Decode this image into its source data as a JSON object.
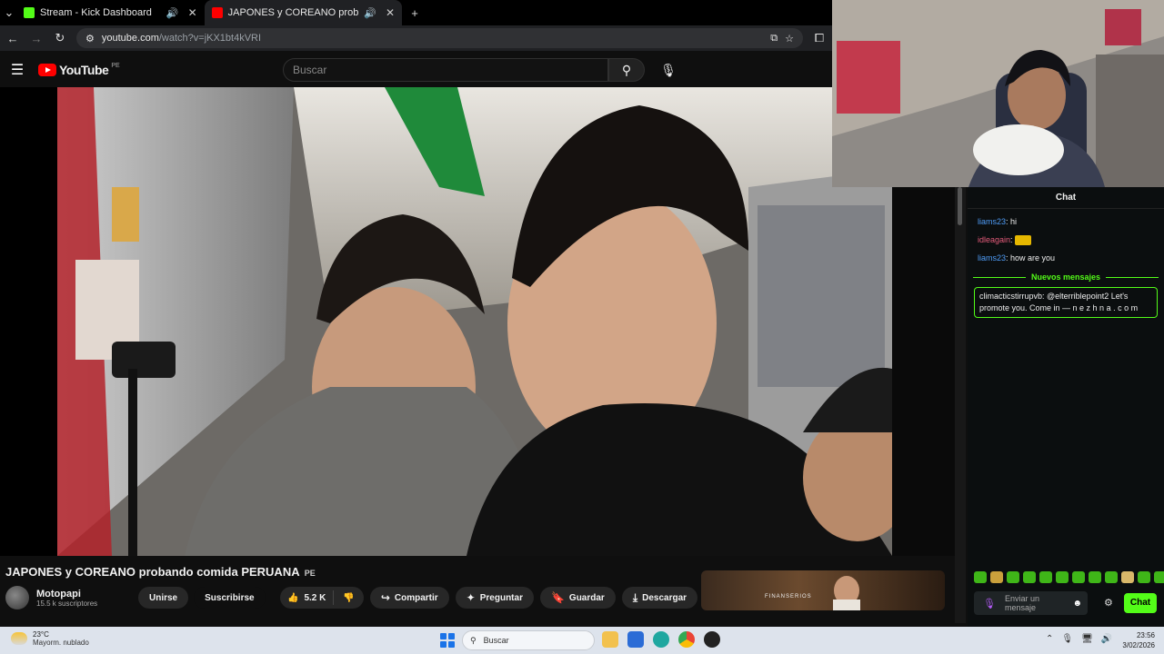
{
  "browser": {
    "tabs": [
      {
        "title": "Stream - Kick Dashboard",
        "favicon_color": "#53fc18"
      },
      {
        "title": "JAPONES y COREANO prob",
        "favicon_color": "#ff0000"
      }
    ],
    "url_host": "youtube.com",
    "url_path": "/watch?v=jKX1bt4kVRI"
  },
  "youtube": {
    "logo_text": "YouTube",
    "country": "PE",
    "search_placeholder": "Buscar"
  },
  "video": {
    "title": "JAPONES y COREANO probando comida PERUANA",
    "title_badge": "PE",
    "channel": "Motopapi",
    "subscribers": "15.5 k suscriptores",
    "join_label": "Unirse",
    "subscribe_label": "Suscribirse",
    "likes": "5.2 K",
    "share_label": "Compartir",
    "ask_label": "Preguntar",
    "save_label": "Guardar",
    "download_label": "Descargar",
    "ad_brand": "FINANSERIOS"
  },
  "chat": {
    "header": "Chat",
    "messages": [
      {
        "user": "liams23",
        "text": "hi"
      },
      {
        "user": "idleagain",
        "text": ""
      },
      {
        "user": "liams23",
        "text": "how are you"
      }
    ],
    "new_messages_label": "Nuevos mensajes",
    "highlight": {
      "user": "climacticstirrupvb",
      "text": "@elterriblepoint2 Let's promote you. Come in — n e z h n a . c o m"
    },
    "input_placeholder": "Enviar un mensaje",
    "send_label": "Chat"
  },
  "taskbar": {
    "temperature": "23°C",
    "weather": "Mayorm. nublado",
    "search_label": "Buscar",
    "time": "23:56",
    "date": "3/02/2026"
  }
}
